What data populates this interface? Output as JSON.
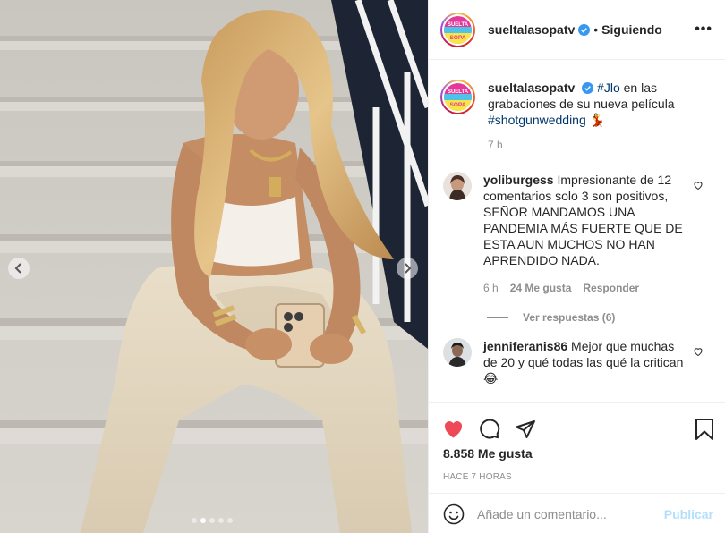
{
  "header": {
    "username": "sueltalasopatv",
    "separator": "•",
    "follow_status": "Siguiendo",
    "more_label": "•••"
  },
  "caption": {
    "username": "sueltalasopatv",
    "mention": "#Jlo",
    "text": " en las grabaciones de su nueva película ",
    "hashtag": "#shotgunwedding",
    "emoji": "💃",
    "time": "7 h"
  },
  "comments": [
    {
      "username": "yoliburgess",
      "text": "Impresionante de 12 comentarios solo 3 son positivos, SEÑOR MANDAMOS UNA PANDEMIA MÁS FUERTE QUE DE ESTA AUN MUCHOS NO HAN APRENDIDO NADA.",
      "time": "6 h",
      "likes": "24 Me gusta",
      "reply": "Responder",
      "view_replies": "Ver respuestas (6)"
    },
    {
      "username": "jenniferanis86",
      "text": "Mejor que muchas de 20 y qué todas las qué la critican",
      "emoji": "😂"
    }
  ],
  "actions": {
    "likes": "8.858 Me gusta",
    "ago": "HACE 7 HORAS"
  },
  "add_comment": {
    "emoji": "☺",
    "placeholder": "Añade un comentario...",
    "publish": "Publicar"
  },
  "logo_text": {
    "line1": "SUELTA",
    "line2": "la",
    "line3": "SOPA"
  },
  "colors": {
    "like_red": "#ed4956",
    "verified_blue": "#3897f0",
    "link_blue": "#00376b",
    "publish_disabled": "#b2dffc"
  },
  "carousel": {
    "slide": 2,
    "total": 5
  },
  "icons": [
    "chevron-left-icon",
    "chevron-right-icon",
    "verified-icon",
    "more-icon",
    "heart-icon",
    "comment-icon",
    "share-icon",
    "bookmark-icon",
    "emoji-icon"
  ]
}
